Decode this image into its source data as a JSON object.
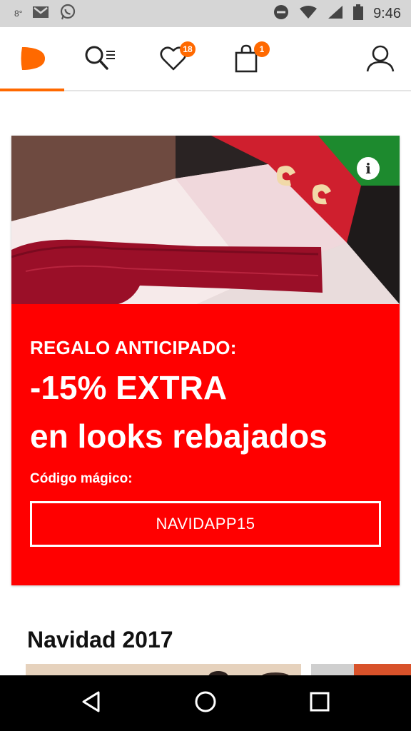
{
  "status_bar": {
    "left_text": "8°",
    "left_icons": [
      "gmail-icon",
      "whatsapp-icon"
    ],
    "right_icons": [
      "do-not-disturb-icon",
      "wifi-icon",
      "signal-icon",
      "battery-icon"
    ],
    "time": "9:46"
  },
  "header": {
    "logo": "zalando-logo-icon",
    "wishlist_count": "18",
    "bag_count": "1",
    "accent_color": "#ff6900"
  },
  "promo": {
    "kicker": "REGALO ANTICIPADO:",
    "headline_line1": "-15% EXTRA",
    "headline_line2": "en looks rebajados",
    "code_label": "Código mágico:",
    "code": "NAVIDAPP15",
    "info_glyph": "i",
    "background_color": "#ff0000"
  },
  "section": {
    "title": "Navidad 2017"
  },
  "nav_bar": {
    "buttons": [
      "back-icon",
      "home-icon",
      "recents-icon"
    ]
  }
}
